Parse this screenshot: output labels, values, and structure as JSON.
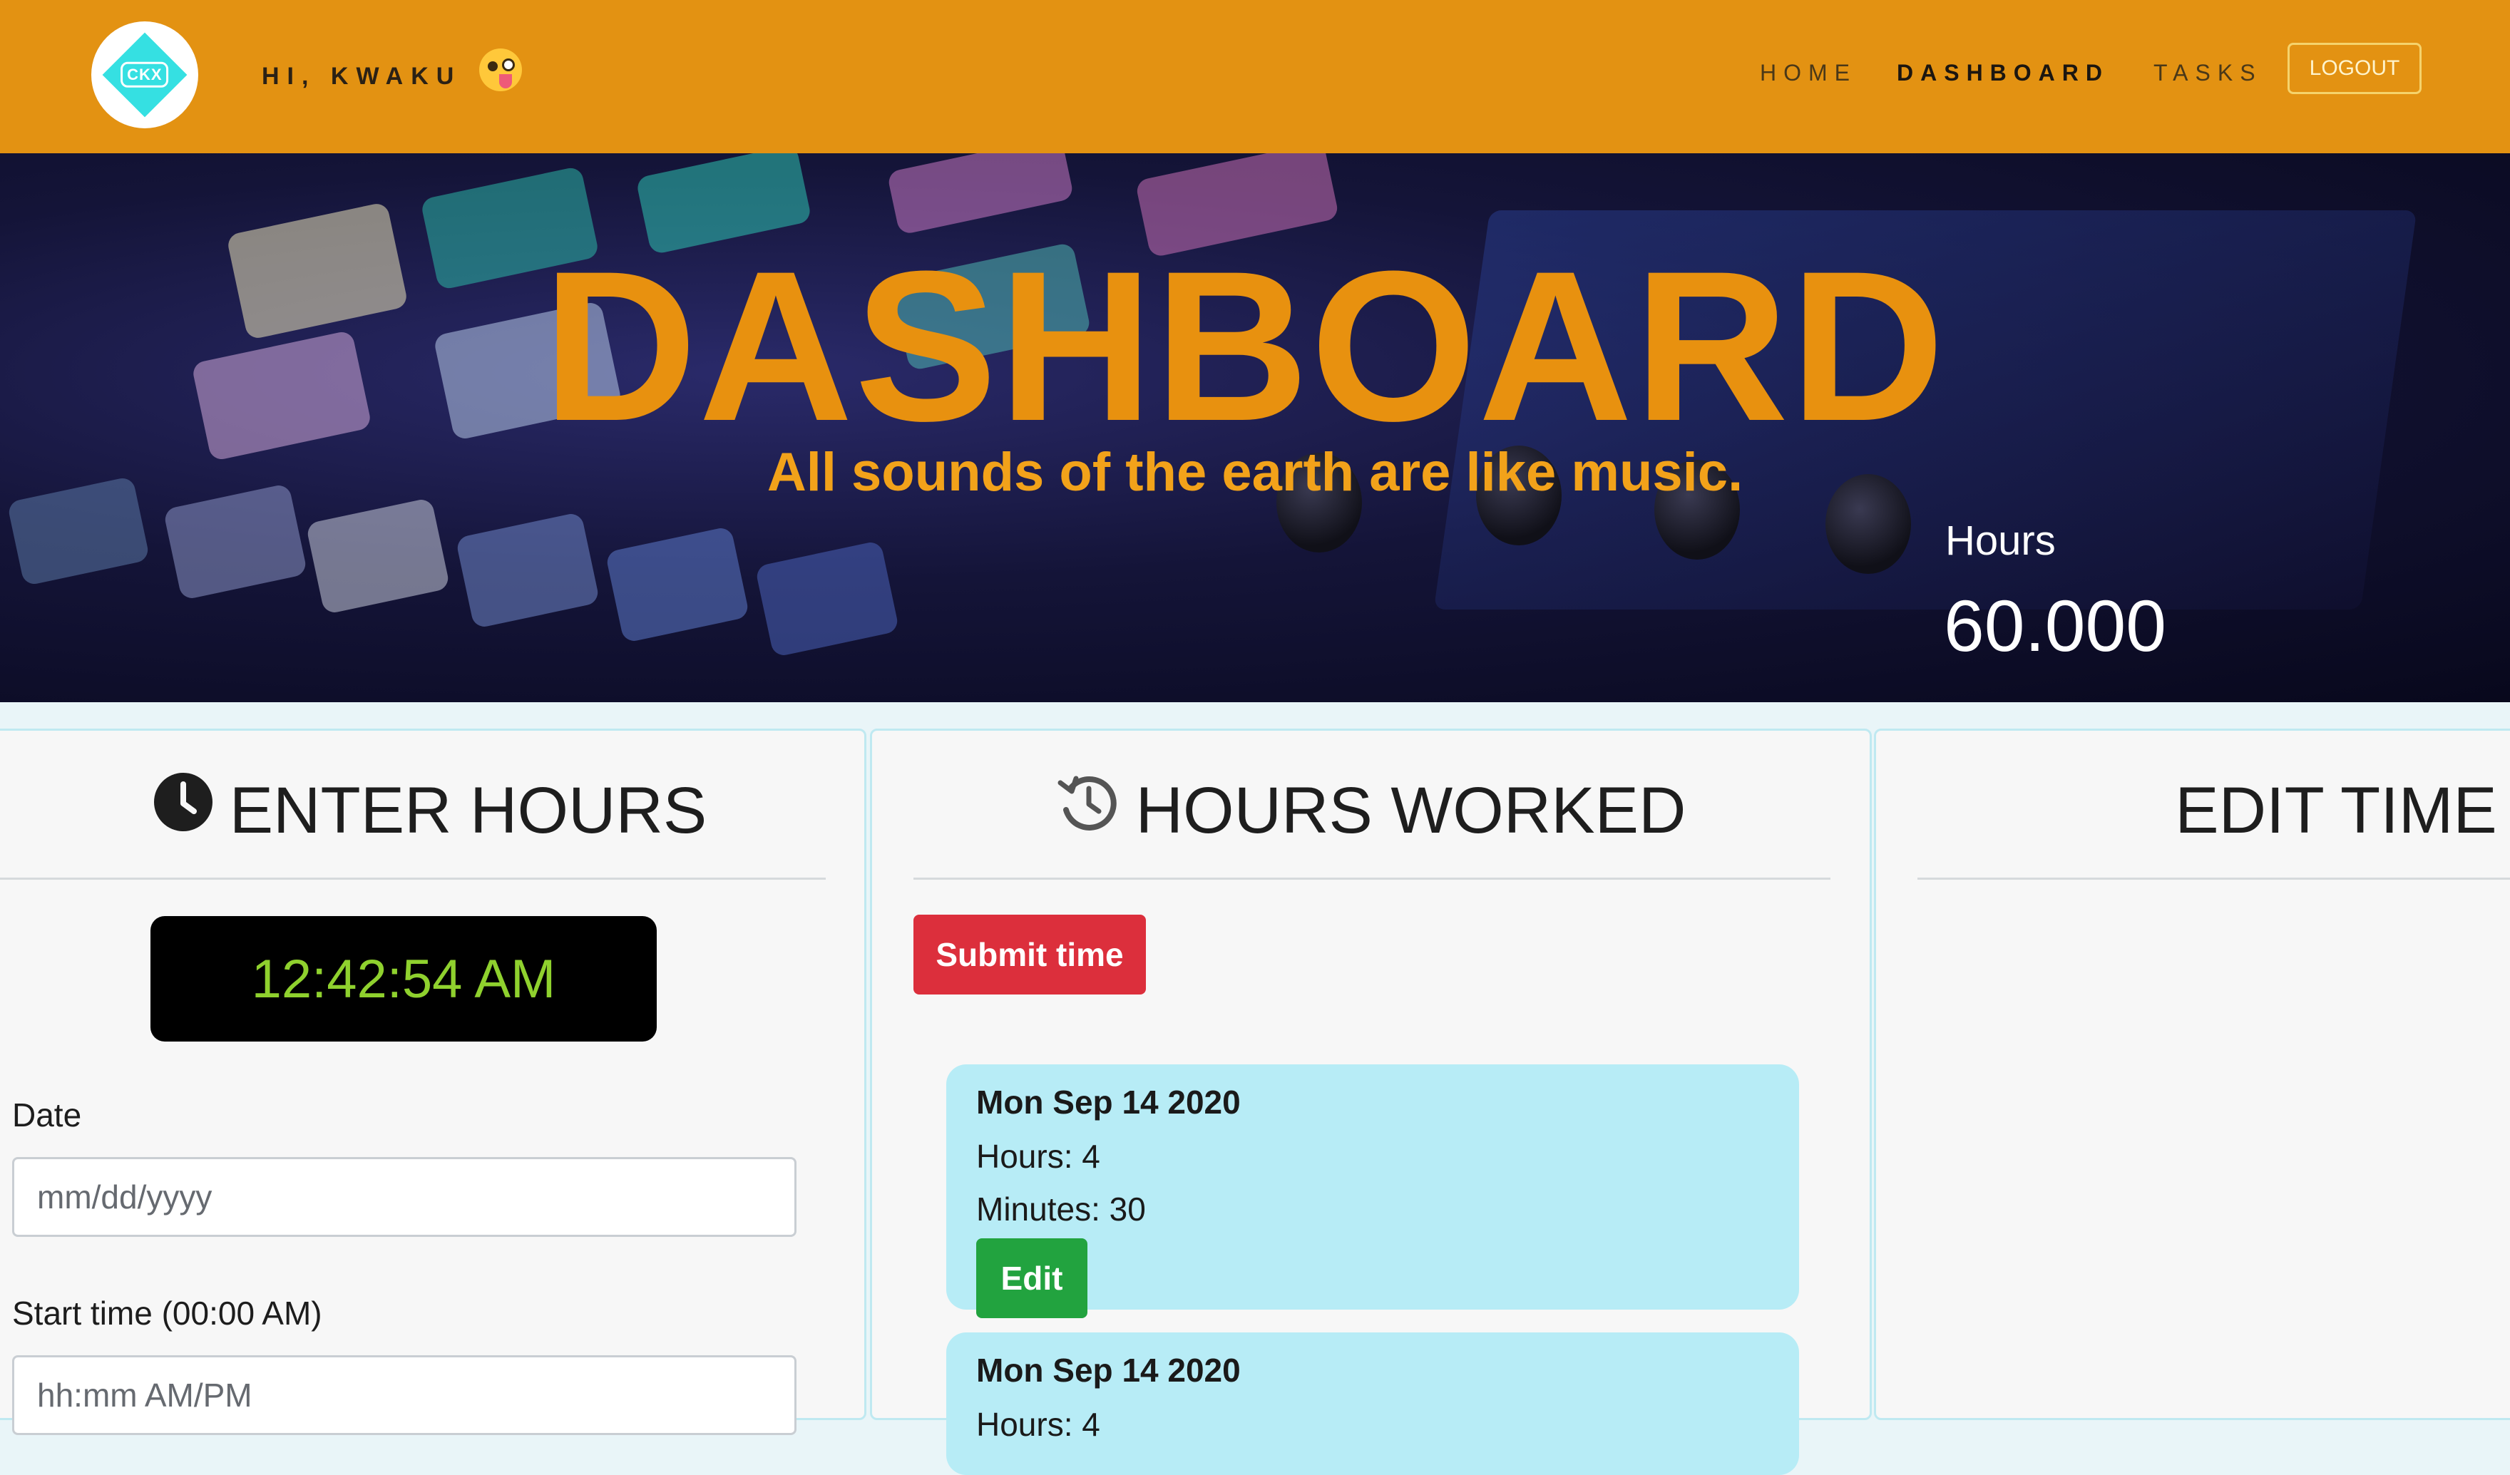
{
  "nav": {
    "logo_text": "CKX",
    "greeting": "HI, KWAKU",
    "emoji_icon": "winking-tongue-face-icon",
    "links": [
      "HOME",
      "DASHBOARD",
      "TASKS"
    ],
    "active_link": "DASHBOARD",
    "logout_label": "LOGOUT",
    "accent_color": "#e39212"
  },
  "hero": {
    "title": "DASHBOARD",
    "tagline": "All sounds of the earth are like music.",
    "hours_label": "Hours",
    "hours_value": "60.000"
  },
  "enter_hours": {
    "header": "ENTER HOURS",
    "icon": "clock-icon",
    "clock": "12:42:54 AM",
    "date_label": "Date",
    "date_placeholder": "mm/dd/yyyy",
    "start_label": "Start time (00:00 AM)",
    "start_placeholder": "hh:mm AM/PM"
  },
  "hours_worked": {
    "header": "HOURS WORKED",
    "icon": "history-icon",
    "submit_label": "Submit time",
    "entries": [
      {
        "date": "Mon Sep 14 2020",
        "hours": "Hours: 4",
        "minutes": "Minutes: 30",
        "edit_label": "Edit"
      },
      {
        "date": "Mon Sep 14 2020",
        "hours": "Hours: 4"
      }
    ]
  },
  "edit_time": {
    "header": "EDIT TIME"
  }
}
